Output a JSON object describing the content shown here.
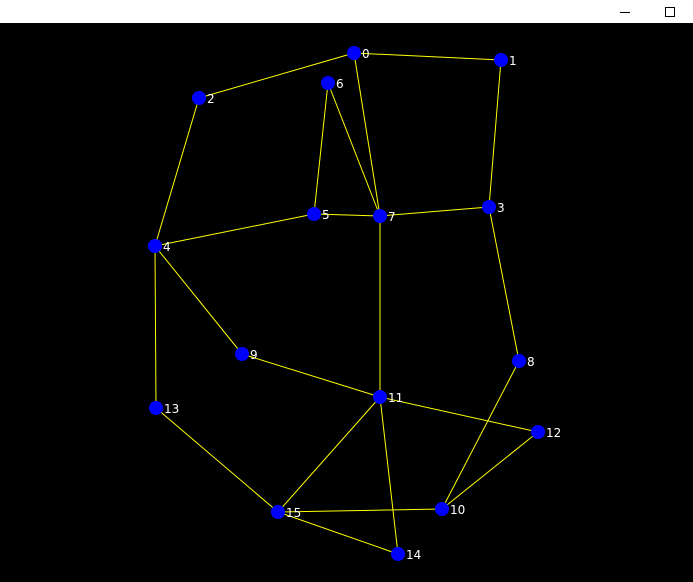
{
  "window": {
    "minimize_icon": "minimize-icon",
    "maximize_icon": "maximize-icon",
    "titlebar_color": "#ffffff"
  },
  "colors": {
    "background": "#000000",
    "edge": "#ffff00",
    "node": "#0000ff",
    "label": "#ffffff"
  },
  "graph": {
    "nodes": [
      {
        "id": "0",
        "label": "0"
      },
      {
        "id": "1",
        "label": "1"
      },
      {
        "id": "2",
        "label": "2"
      },
      {
        "id": "3",
        "label": "3"
      },
      {
        "id": "4",
        "label": "4"
      },
      {
        "id": "5",
        "label": "5"
      },
      {
        "id": "6",
        "label": "6"
      },
      {
        "id": "7",
        "label": "7"
      },
      {
        "id": "8",
        "label": "8"
      },
      {
        "id": "9",
        "label": "9"
      },
      {
        "id": "10",
        "label": "10"
      },
      {
        "id": "11",
        "label": "11"
      },
      {
        "id": "12",
        "label": "12"
      },
      {
        "id": "13",
        "label": "13"
      },
      {
        "id": "14",
        "label": "14"
      },
      {
        "id": "15",
        "label": "15"
      }
    ],
    "edges": [
      [
        "0",
        "1"
      ],
      [
        "0",
        "2"
      ],
      [
        "0",
        "7"
      ],
      [
        "1",
        "3"
      ],
      [
        "2",
        "4"
      ],
      [
        "6",
        "5"
      ],
      [
        "6",
        "7"
      ],
      [
        "5",
        "7"
      ],
      [
        "7",
        "3"
      ],
      [
        "4",
        "5"
      ],
      [
        "3",
        "8"
      ],
      [
        "4",
        "9"
      ],
      [
        "4",
        "13"
      ],
      [
        "7",
        "11"
      ],
      [
        "9",
        "11"
      ],
      [
        "11",
        "12"
      ],
      [
        "8",
        "10"
      ],
      [
        "12",
        "10"
      ],
      [
        "11",
        "15"
      ],
      [
        "11",
        "14"
      ],
      [
        "13",
        "15"
      ],
      [
        "15",
        "10"
      ],
      [
        "15",
        "14"
      ]
    ]
  }
}
